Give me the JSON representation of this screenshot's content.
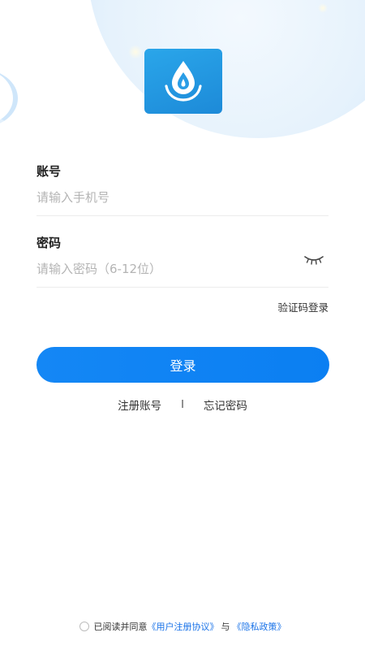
{
  "account": {
    "label": "账号",
    "placeholder": "请输入手机号",
    "value": ""
  },
  "password": {
    "label": "密码",
    "placeholder": "请输入密码（6-12位）",
    "value": "",
    "toggle_icon": "eye-closed-icon"
  },
  "sms_login_label": "验证码登录",
  "login_button_label": "登录",
  "links": {
    "register_label": "注册账号",
    "separator": "I",
    "forgot_label": "忘记密码"
  },
  "agreement": {
    "prefix": "已阅读并同意",
    "user_agreement_label": "《用户注册协议》",
    "conjunction": "与",
    "privacy_policy_label": "《隐私政策》"
  },
  "colors": {
    "primary": "#0b7ff2",
    "link": "#1a73e8",
    "logo_bg": "#1d8ad8"
  }
}
